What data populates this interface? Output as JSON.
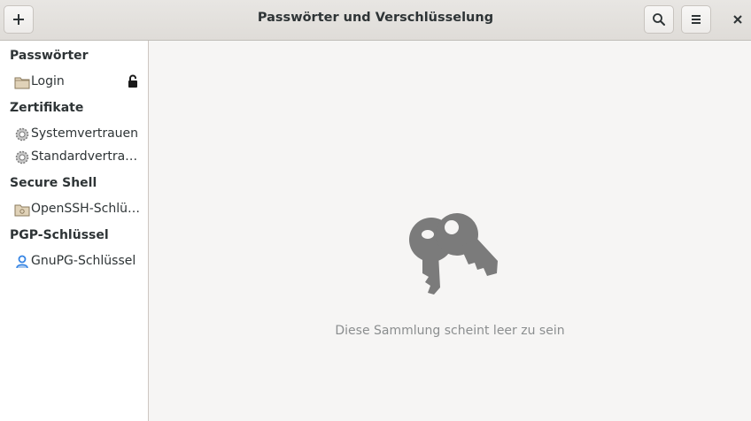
{
  "window": {
    "title": "Passwörter und Verschlüsselung",
    "add_icon": "plus-icon",
    "search_icon": "search-icon",
    "menu_icon": "hamburger-menu-icon",
    "close_icon": "close-icon"
  },
  "sidebar": {
    "sections": [
      {
        "heading": "Passwörter",
        "items": [
          {
            "label": "Login",
            "icon": "folder-icon",
            "locked": true
          }
        ]
      },
      {
        "heading": "Zertifikate",
        "items": [
          {
            "label": "Systemvertrauen",
            "icon": "gear-icon"
          },
          {
            "label": "Standardvertrauen",
            "icon": "gear-icon"
          }
        ]
      },
      {
        "heading": "Secure Shell",
        "items": [
          {
            "label": "OpenSSH-Schlüssel",
            "icon": "key-folder-icon"
          }
        ]
      },
      {
        "heading": "PGP-Schlüssel",
        "items": [
          {
            "label": "GnuPG-Schlüssel",
            "icon": "user-key-icon"
          }
        ]
      }
    ]
  },
  "main": {
    "empty_icon": "keys-icon",
    "empty_message": "Diese Sammlung scheint leer zu sein"
  },
  "colors": {
    "accent": "#3584e4",
    "icon_gray": "#7b7b7b",
    "placeholder_text": "#8b8e8f"
  }
}
